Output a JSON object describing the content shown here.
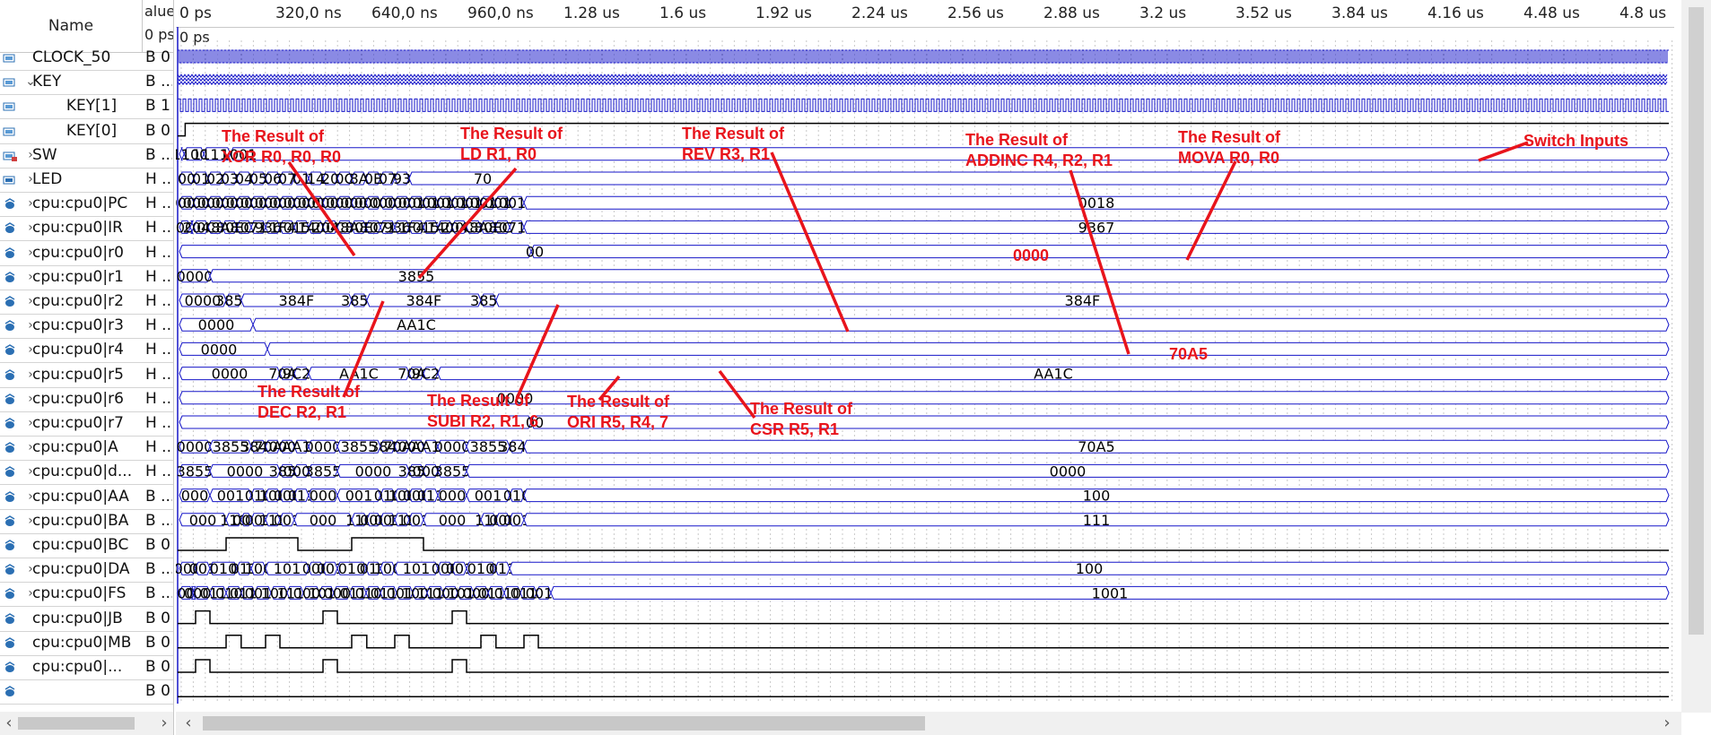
{
  "headers": {
    "name": "Name",
    "value_top": "alue",
    "value_bottom": "0 ps"
  },
  "cursor_label": "0 ps",
  "ticks": [
    "0 ps",
    "320,0 ns",
    "640,0 ns",
    "960,0 ns",
    "1.28 us",
    "1.6 us",
    "1.92 us",
    "2.24 us",
    "2.56 us",
    "2.88 us",
    "3.2 us",
    "3.52 us",
    "3.84 us",
    "4.16 us",
    "4.48 us",
    "4.8 us"
  ],
  "colors": {
    "wave": "#1616c8",
    "annotation": "#e8141c",
    "bus_text": "#000000"
  },
  "signals": [
    {
      "name": "CLOCK_50",
      "value": "B 0",
      "icon": "input-pin-icon",
      "expand": false,
      "indent": 0,
      "kind": "clock",
      "period": 4
    },
    {
      "name": "KEY",
      "value": "B ...",
      "icon": "input-pin-icon",
      "expand": "open",
      "indent": 0,
      "kind": "dense"
    },
    {
      "name": "KEY[1]",
      "value": "B 1",
      "icon": "input-pin-icon",
      "expand": false,
      "indent": 1,
      "kind": "clock",
      "period": 6
    },
    {
      "name": "KEY[0]",
      "value": "B 0",
      "icon": "input-pin-icon",
      "expand": false,
      "indent": 1,
      "kind": "step",
      "initial": 0,
      "edges": [
        [
          0.16,
          1
        ]
      ]
    },
    {
      "name": "SW",
      "value": "B ...",
      "icon": "input-bus-icon",
      "expand": "closed",
      "indent": 0,
      "kind": "bus",
      "segments": [
        [
          0,
          "",
          0
        ],
        [
          0.13,
          "1100",
          0.3
        ],
        [
          0.68,
          "1111",
          0.86
        ],
        [
          1.42,
          "1001",
          1.65
        ]
      ]
    },
    {
      "name": "LED",
      "value": "H ...",
      "icon": "output-pin-icon",
      "expand": "closed",
      "indent": 0,
      "kind": "bus",
      "segments": [
        [
          0,
          "00"
        ],
        [
          0.4,
          "01"
        ],
        [
          0.8,
          "02"
        ],
        [
          1.2,
          "03"
        ],
        [
          1.6,
          "04"
        ],
        [
          2.0,
          "05"
        ],
        [
          2.4,
          "06"
        ],
        [
          2.8,
          "07"
        ],
        [
          3.2,
          "01"
        ],
        [
          3.6,
          "14"
        ],
        [
          4.0,
          "20"
        ],
        [
          4.4,
          "0C"
        ],
        [
          4.8,
          "8A"
        ],
        [
          5.2,
          "0E"
        ],
        [
          5.6,
          "07"
        ],
        [
          6.0,
          "93"
        ],
        [
          6.4,
          "70",
          8.45
        ]
      ]
    },
    {
      "name": "cpu:cpu0|PC",
      "value": "H ...",
      "icon": "node-icon",
      "expand": "closed",
      "indent": 0,
      "kind": "bus",
      "segments": [
        [
          0,
          "0000"
        ],
        [
          0.4,
          "0001"
        ],
        [
          0.8,
          "0002"
        ],
        [
          1.2,
          "0003"
        ],
        [
          1.6,
          "0004"
        ],
        [
          2.0,
          "0005"
        ],
        [
          2.4,
          "0006"
        ],
        [
          2.8,
          "0007"
        ],
        [
          3.2,
          "0008"
        ],
        [
          3.6,
          "0009"
        ],
        [
          4.0,
          "000A"
        ],
        [
          4.4,
          "000B"
        ],
        [
          4.8,
          "000C"
        ],
        [
          5.2,
          "000D"
        ],
        [
          5.6,
          "000E"
        ],
        [
          6.0,
          "000F"
        ],
        [
          6.4,
          "0010"
        ],
        [
          6.8,
          "0011"
        ],
        [
          7.2,
          "0012"
        ],
        [
          7.6,
          "0013"
        ],
        [
          8.0,
          "0014"
        ],
        [
          8.4,
          "0015"
        ],
        [
          8.8,
          "0016"
        ],
        [
          9.2,
          "0017"
        ],
        [
          9.6,
          "0018"
        ]
      ]
    },
    {
      "name": "cpu:cpu0|IR",
      "value": "H ...",
      "icon": "node-icon",
      "expand": "closed",
      "indent": 0,
      "kind": "bus",
      "segments": [
        [
          0,
          "0000"
        ],
        [
          0.3,
          "X"
        ],
        [
          0.4,
          "2040"
        ],
        [
          0.8,
          "0C88"
        ],
        [
          1.2,
          "8A8E"
        ],
        [
          1.6,
          "0EC8"
        ],
        [
          2.0,
          "0711"
        ],
        [
          2.4,
          "9367"
        ],
        [
          2.8,
          "1F41"
        ],
        [
          3.2,
          "0158"
        ],
        [
          3.6,
          "1400"
        ],
        [
          4.0,
          "2040"
        ],
        [
          4.4,
          "0C88"
        ],
        [
          4.8,
          "8A8E"
        ],
        [
          5.2,
          "0EC8"
        ],
        [
          5.6,
          "0711"
        ],
        [
          6.0,
          "9367"
        ],
        [
          6.4,
          "1F41"
        ],
        [
          6.8,
          "0158"
        ],
        [
          7.2,
          "1400"
        ],
        [
          7.6,
          "2040"
        ],
        [
          8.0,
          "0C88"
        ],
        [
          8.4,
          "8A8E"
        ],
        [
          8.8,
          "0EC8"
        ],
        [
          9.2,
          "0711"
        ],
        [
          9.6,
          "9367"
        ]
      ]
    },
    {
      "name": "cpu:cpu0|r0",
      "value": "H ...",
      "icon": "node-icon",
      "expand": "closed",
      "indent": 0,
      "kind": "bus",
      "segments": [
        [
          0,
          "",
          0
        ],
        [
          9.8,
          "00",
          9.9
        ]
      ]
    },
    {
      "name": "cpu:cpu0|r1",
      "value": "H ...",
      "icon": "node-icon",
      "expand": "closed",
      "indent": 0,
      "kind": "bus",
      "segments": [
        [
          0,
          "0000"
        ],
        [
          0.85,
          "3855",
          6.6
        ]
      ]
    },
    {
      "name": "cpu:cpu0|r2",
      "value": "H ...",
      "icon": "node-icon",
      "expand": "closed",
      "indent": 0,
      "kind": "bus",
      "segments": [
        [
          0,
          "0000"
        ],
        [
          1.3,
          "3854"
        ],
        [
          1.72,
          "384F"
        ],
        [
          4.8,
          "3854"
        ],
        [
          5.22,
          "384F"
        ],
        [
          8.4,
          "3854"
        ],
        [
          8.82,
          "384F",
          -1
        ]
      ]
    },
    {
      "name": "cpu:cpu0|r3",
      "value": "H ...",
      "icon": "node-icon",
      "expand": "closed",
      "indent": 0,
      "kind": "bus",
      "segments": [
        [
          0,
          "0000"
        ],
        [
          2.05,
          "AA1C",
          6.6
        ]
      ]
    },
    {
      "name": "cpu:cpu0|r4",
      "value": "H ...",
      "icon": "node-icon",
      "expand": "closed",
      "indent": 0,
      "kind": "bus",
      "segments": [
        [
          0,
          "0000",
          1.1
        ],
        [
          2.45,
          "",
          6.6
        ]
      ]
    },
    {
      "name": "cpu:cpu0|r5",
      "value": "H ...",
      "icon": "node-icon",
      "expand": "closed",
      "indent": 0,
      "kind": "bus",
      "segments": [
        [
          0,
          "0000"
        ],
        [
          2.8,
          "70A7"
        ],
        [
          3.2,
          "9C2A"
        ],
        [
          3.6,
          "AA1C"
        ],
        [
          6.4,
          "70A7"
        ],
        [
          6.8,
          "9C2A"
        ],
        [
          7.2,
          "AA1C"
        ]
      ]
    },
    {
      "name": "cpu:cpu0|r6",
      "value": "H ...",
      "icon": "node-icon",
      "expand": "closed",
      "indent": 0,
      "kind": "bus",
      "segments": [
        [
          0,
          "0000",
          9.35
        ]
      ]
    },
    {
      "name": "cpu:cpu0|r7",
      "value": "H ...",
      "icon": "node-icon",
      "expand": "closed",
      "indent": 0,
      "kind": "bus",
      "segments": [
        [
          0,
          "",
          0
        ],
        [
          9.8,
          "00",
          9.9
        ]
      ]
    },
    {
      "name": "cpu:cpu0|A",
      "value": "H ...",
      "icon": "node-icon",
      "expand": "closed",
      "indent": 0,
      "kind": "bus",
      "segments": [
        [
          0,
          "0000"
        ],
        [
          0.85,
          "3855"
        ],
        [
          2.0,
          "384F"
        ],
        [
          2.4,
          "70A5"
        ],
        [
          2.8,
          "0000"
        ],
        [
          3.2,
          "AA1C"
        ],
        [
          3.6,
          "0000"
        ],
        [
          4.4,
          "3855"
        ],
        [
          5.6,
          "384F"
        ],
        [
          6.0,
          "70A5"
        ],
        [
          6.4,
          "0000"
        ],
        [
          6.8,
          "AA1C"
        ],
        [
          7.2,
          "0000"
        ],
        [
          8.0,
          "3855"
        ],
        [
          9.2,
          "384F"
        ],
        [
          9.6,
          "70A5"
        ]
      ]
    },
    {
      "name": "cpu:cpu0|d...",
      "value": "H ...",
      "icon": "node-icon",
      "expand": "closed",
      "indent": 0,
      "kind": "bus",
      "segments": [
        [
          0,
          "3855"
        ],
        [
          0.85,
          "0000"
        ],
        [
          2.8,
          "3855"
        ],
        [
          3.2,
          "0000"
        ],
        [
          3.6,
          "3855"
        ],
        [
          4.4,
          "0000"
        ],
        [
          6.4,
          "3855"
        ],
        [
          6.8,
          "0000"
        ],
        [
          7.2,
          "3855"
        ],
        [
          8.0,
          "0000"
        ]
      ]
    },
    {
      "name": "cpu:cpu0|AA",
      "value": "B ...",
      "icon": "node-icon",
      "expand": "closed",
      "indent": 0,
      "kind": "bus",
      "segments": [
        [
          0,
          "000"
        ],
        [
          0.85,
          "001"
        ],
        [
          2.0,
          "010"
        ],
        [
          2.4,
          "100"
        ],
        [
          2.8,
          "000"
        ],
        [
          3.2,
          "011"
        ],
        [
          3.6,
          "000"
        ],
        [
          4.4,
          "001"
        ],
        [
          5.6,
          "010"
        ],
        [
          6.0,
          "100"
        ],
        [
          6.4,
          "000"
        ],
        [
          6.8,
          "011"
        ],
        [
          7.2,
          "000"
        ],
        [
          8.0,
          "001"
        ],
        [
          9.2,
          "010"
        ],
        [
          9.6,
          "100"
        ]
      ]
    },
    {
      "name": "cpu:cpu0|BA",
      "value": "B ...",
      "icon": "node-icon",
      "expand": "closed",
      "indent": 0,
      "kind": "bus",
      "segments": [
        [
          0,
          "000"
        ],
        [
          1.3,
          "110"
        ],
        [
          1.72,
          "000"
        ],
        [
          2.0,
          "001"
        ],
        [
          2.4,
          "111"
        ],
        [
          2.8,
          "001"
        ],
        [
          3.2,
          "000"
        ],
        [
          4.8,
          "110"
        ],
        [
          5.22,
          "000"
        ],
        [
          5.6,
          "001"
        ],
        [
          6.0,
          "111"
        ],
        [
          6.4,
          "001"
        ],
        [
          6.8,
          "000"
        ],
        [
          8.4,
          "110"
        ],
        [
          8.82,
          "000"
        ],
        [
          9.2,
          "001"
        ],
        [
          9.6,
          "111"
        ]
      ]
    },
    {
      "name": "cpu:cpu0|BC",
      "value": "B 0",
      "icon": "node-icon",
      "expand": false,
      "indent": 0,
      "kind": "step",
      "initial": 0,
      "edges": [
        [
          1.3,
          1
        ],
        [
          3.3,
          0
        ],
        [
          4.8,
          1
        ],
        [
          6.8,
          0
        ]
      ]
    },
    {
      "name": "cpu:cpu0|DA",
      "value": "B ...",
      "icon": "node-icon",
      "expand": "closed",
      "indent": 0,
      "kind": "bus",
      "segments": [
        [
          0,
          "000"
        ],
        [
          0.45,
          "001"
        ],
        [
          0.85,
          "010"
        ],
        [
          1.6,
          "011"
        ],
        [
          2.0,
          "100"
        ],
        [
          2.4,
          "101"
        ],
        [
          3.6,
          "000"
        ],
        [
          4.0,
          "001"
        ],
        [
          4.4,
          "010"
        ],
        [
          5.2,
          "011"
        ],
        [
          5.6,
          "100"
        ],
        [
          6.0,
          "101"
        ],
        [
          7.2,
          "000"
        ],
        [
          7.6,
          "001"
        ],
        [
          8.0,
          "010"
        ],
        [
          8.8,
          "011"
        ],
        [
          9.2,
          "100"
        ]
      ]
    },
    {
      "name": "cpu:cpu0|FS",
      "value": "B ...",
      "icon": "node-icon",
      "expand": "closed",
      "indent": 0,
      "kind": "bus",
      "segments": [
        [
          0,
          "0000"
        ],
        [
          0.37,
          "X"
        ],
        [
          0.42,
          "0000"
        ],
        [
          0.85,
          "0110"
        ],
        [
          1.3,
          "0101"
        ],
        [
          1.72,
          "0111"
        ],
        [
          2.1,
          "0011"
        ],
        [
          2.55,
          "1001"
        ],
        [
          3.0,
          "1111"
        ],
        [
          3.45,
          "0000"
        ],
        [
          3.9,
          "1010"
        ],
        [
          4.3,
          "0000"
        ],
        [
          4.75,
          "0110"
        ],
        [
          5.2,
          "0101"
        ],
        [
          5.6,
          "0111"
        ],
        [
          6.05,
          "0011"
        ],
        [
          6.5,
          "1001"
        ],
        [
          6.9,
          "1111"
        ],
        [
          7.35,
          "0000"
        ],
        [
          7.75,
          "1010"
        ],
        [
          8.2,
          "0000"
        ],
        [
          8.6,
          "0110"
        ],
        [
          9.05,
          "0101"
        ],
        [
          9.5,
          "0111"
        ],
        [
          9.95,
          "0011"
        ],
        [
          10.35,
          "1001"
        ]
      ]
    },
    {
      "name": "cpu:cpu0|JB",
      "value": "B 0",
      "icon": "node-icon",
      "expand": false,
      "indent": 0,
      "kind": "step",
      "initial": 0,
      "edges": [
        [
          0.45,
          1
        ],
        [
          0.85,
          0
        ],
        [
          4.0,
          1
        ],
        [
          4.4,
          0
        ],
        [
          7.6,
          1
        ],
        [
          8.0,
          0
        ]
      ]
    },
    {
      "name": "cpu:cpu0|MB",
      "value": "B 0",
      "icon": "node-icon",
      "expand": false,
      "indent": 0,
      "kind": "step",
      "initial": 0,
      "edges": [
        [
          1.3,
          1
        ],
        [
          1.72,
          0
        ],
        [
          2.4,
          1
        ],
        [
          2.8,
          0
        ],
        [
          4.8,
          1
        ],
        [
          5.22,
          0
        ],
        [
          6.0,
          1
        ],
        [
          6.4,
          0
        ],
        [
          8.4,
          1
        ],
        [
          8.82,
          0
        ],
        [
          9.6,
          1
        ],
        [
          10.0,
          0
        ]
      ]
    },
    {
      "name": "cpu:cpu0|...",
      "value": "B 0",
      "icon": "node-icon",
      "expand": false,
      "indent": 0,
      "kind": "step",
      "initial": 0,
      "edges": [
        [
          0.45,
          1
        ],
        [
          0.85,
          0
        ],
        [
          4.0,
          1
        ],
        [
          4.4,
          0
        ],
        [
          7.6,
          1
        ],
        [
          8.0,
          0
        ]
      ]
    },
    {
      "name": "",
      "value": "B 0",
      "icon": "node-icon",
      "expand": false,
      "indent": 0,
      "kind": "step",
      "initial": 0,
      "edges": []
    }
  ],
  "annotations": [
    {
      "lines": [
        "The Result of",
        "XOR R0, R0, R0"
      ]
    },
    {
      "lines": [
        "The Result of",
        "LD R1, R0"
      ]
    },
    {
      "lines": [
        "The Result of",
        "REV R3, R1"
      ]
    },
    {
      "lines": [
        "The Result of",
        "ADDINC R4, R2, R1"
      ]
    },
    {
      "lines": [
        "The Result of",
        "MOVA R0, R0"
      ]
    },
    {
      "lines": [
        "Switch Inputs"
      ]
    },
    {
      "lines": [
        "0000"
      ]
    },
    {
      "lines": [
        "70A5"
      ]
    },
    {
      "lines": [
        "The Result of",
        "DEC R2, R1"
      ]
    },
    {
      "lines": [
        "The Result of",
        "SUBI R2, R1, 6"
      ]
    },
    {
      "lines": [
        "The Result of",
        "ORI R5, R4, 7"
      ]
    },
    {
      "lines": [
        "The Result of",
        "CSR R5, R1"
      ]
    }
  ]
}
